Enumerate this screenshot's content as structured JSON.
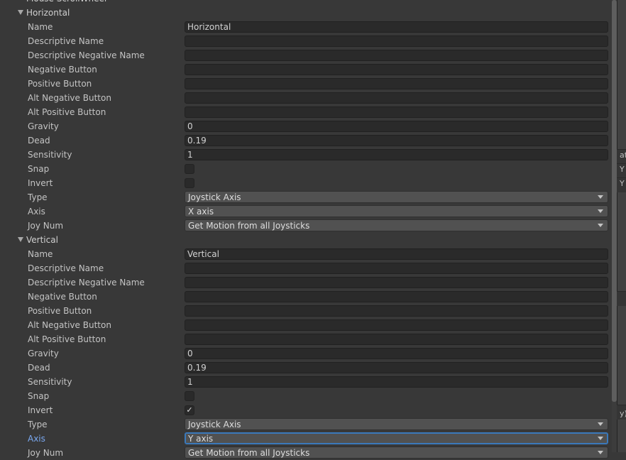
{
  "top_partial_label": "Mouse ScrollWheel",
  "groups": [
    {
      "title": "Horizontal",
      "fields": [
        {
          "kind": "text",
          "label": "Name",
          "value": "Horizontal"
        },
        {
          "kind": "text",
          "label": "Descriptive Name",
          "value": ""
        },
        {
          "kind": "text",
          "label": "Descriptive Negative Name",
          "value": ""
        },
        {
          "kind": "text",
          "label": "Negative Button",
          "value": ""
        },
        {
          "kind": "text",
          "label": "Positive Button",
          "value": ""
        },
        {
          "kind": "text",
          "label": "Alt Negative Button",
          "value": ""
        },
        {
          "kind": "text",
          "label": "Alt Positive Button",
          "value": ""
        },
        {
          "kind": "text",
          "label": "Gravity",
          "value": "0"
        },
        {
          "kind": "text",
          "label": "Dead",
          "value": "0.19"
        },
        {
          "kind": "text",
          "label": "Sensitivity",
          "value": "1"
        },
        {
          "kind": "check",
          "label": "Snap",
          "checked": false
        },
        {
          "kind": "check",
          "label": "Invert",
          "checked": false
        },
        {
          "kind": "dropdown",
          "label": "Type",
          "value": "Joystick Axis"
        },
        {
          "kind": "dropdown",
          "label": "Axis",
          "value": "X axis"
        },
        {
          "kind": "dropdown",
          "label": "Joy Num",
          "value": "Get Motion from all Joysticks"
        }
      ]
    },
    {
      "title": "Vertical",
      "fields": [
        {
          "kind": "text",
          "label": "Name",
          "value": "Vertical"
        },
        {
          "kind": "text",
          "label": "Descriptive Name",
          "value": ""
        },
        {
          "kind": "text",
          "label": "Descriptive Negative Name",
          "value": ""
        },
        {
          "kind": "text",
          "label": "Negative Button",
          "value": ""
        },
        {
          "kind": "text",
          "label": "Positive Button",
          "value": ""
        },
        {
          "kind": "text",
          "label": "Alt Negative Button",
          "value": ""
        },
        {
          "kind": "text",
          "label": "Alt Positive Button",
          "value": ""
        },
        {
          "kind": "text",
          "label": "Gravity",
          "value": "0"
        },
        {
          "kind": "text",
          "label": "Dead",
          "value": "0.19"
        },
        {
          "kind": "text",
          "label": "Sensitivity",
          "value": "1"
        },
        {
          "kind": "check",
          "label": "Snap",
          "checked": false
        },
        {
          "kind": "check",
          "label": "Invert",
          "checked": true
        },
        {
          "kind": "dropdown",
          "label": "Type",
          "value": "Joystick Axis"
        },
        {
          "kind": "dropdown",
          "label": "Axis",
          "value": "Y axis",
          "focused": true
        },
        {
          "kind": "dropdown",
          "label": "Joy Num",
          "value": "Get Motion from all Joysticks"
        }
      ]
    }
  ],
  "check_glyph": "✓",
  "colors": {
    "background": "#383838",
    "focus": "#3a79bb",
    "active_label": "#7aa8f0"
  },
  "side_panel_fragments": [
    "at",
    "Y",
    "Y",
    "y)"
  ]
}
